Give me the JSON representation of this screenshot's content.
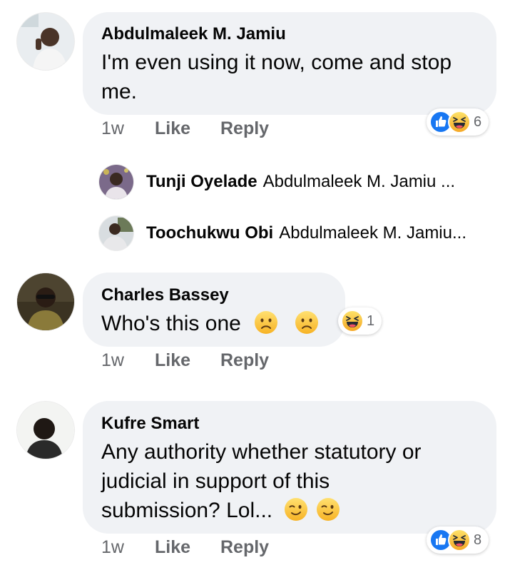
{
  "comments": [
    {
      "author": "Abdulmaleek M. Jamiu",
      "text": "I'm even using it now, come and stop me.",
      "time": "1w",
      "like_label": "Like",
      "reply_label": "Reply",
      "reactions": {
        "icons": [
          "like-icon",
          "haha-icon"
        ],
        "count": "6"
      },
      "replies": [
        {
          "author": "Tunji Oyelade",
          "preview": "Abdulmaleek M. Jamiu ..."
        },
        {
          "author": "Toochukwu Obi",
          "preview": "Abdulmaleek M. Jamiu..."
        }
      ]
    },
    {
      "author": "Charles Bassey",
      "text": "Who's this one",
      "emojis": [
        "frowning-face-emoji",
        "frowning-face-emoji"
      ],
      "time": "1w",
      "like_label": "Like",
      "reply_label": "Reply",
      "reactions": {
        "icons": [
          "haha-icon"
        ],
        "count": "1"
      }
    },
    {
      "author": "Kufre Smart",
      "text_lines": [
        "Any authority whether statutory or",
        "judicial in support of this",
        "submission? Lol..."
      ],
      "emojis": [
        "winking-face-emoji",
        "winking-face-emoji"
      ],
      "time": "1w",
      "like_label": "Like",
      "reply_label": "Reply",
      "reactions": {
        "icons": [
          "like-icon",
          "haha-icon"
        ],
        "count": "8"
      }
    }
  ],
  "colors": {
    "bubble": "#f0f2f5",
    "meta_text": "#65676b",
    "like_blue": "#1877f2",
    "haha_yellow": "#f7b125"
  }
}
